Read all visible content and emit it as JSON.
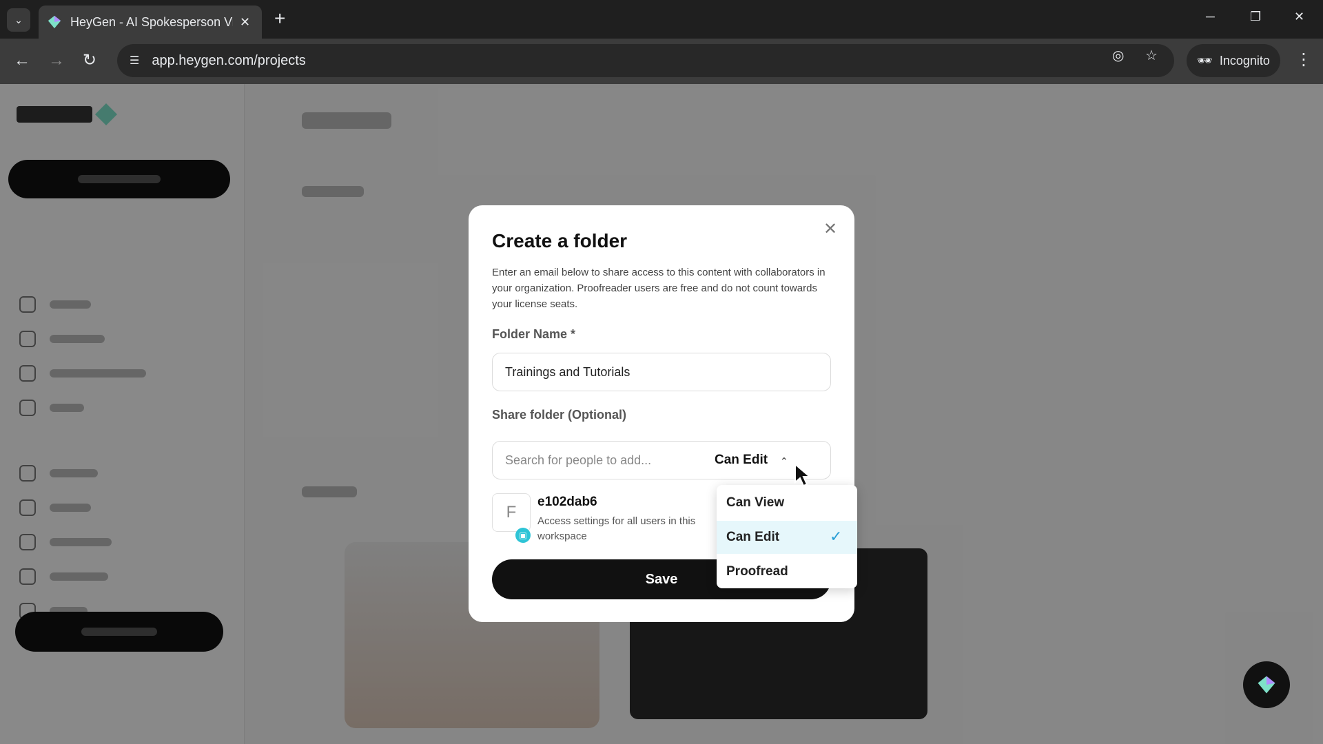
{
  "browser": {
    "tab_title": "HeyGen - AI Spokesperson Vide",
    "url": "app.heygen.com/projects",
    "incognito_label": "Incognito"
  },
  "modal": {
    "title": "Create a folder",
    "description": "Enter an email below to share access to this content with collaborators in your organization. Proofreader users are free and do not count towards your license seats.",
    "folder_name_label": "Folder Name *",
    "folder_name_value": "Trainings and Tutorials",
    "share_label": "Share folder (Optional)",
    "share_placeholder": "Search for people to add...",
    "permission_selected": "Can Edit",
    "member": {
      "avatar_letter": "F",
      "name": "e102dab6",
      "description": "Access settings for all users in this workspace"
    },
    "save_label": "Save"
  },
  "dropdown": {
    "options": [
      "Can View",
      "Can Edit",
      "Proofread"
    ],
    "selected_index": 1
  },
  "colors": {
    "accent": "#2a9fd6",
    "selected_bg": "#e6f7fb",
    "button_dark": "#111111"
  }
}
